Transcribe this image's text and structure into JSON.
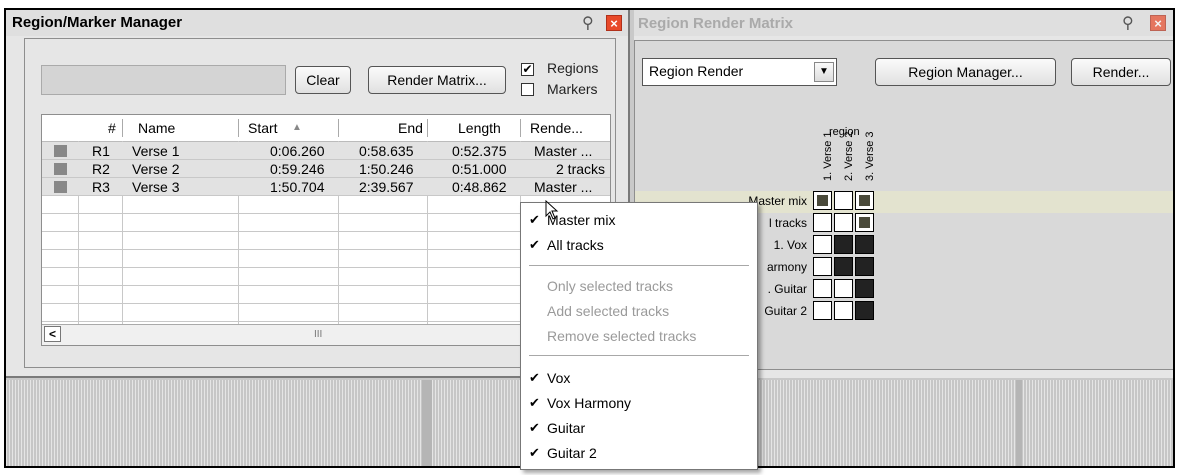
{
  "manager": {
    "title": "Region/Marker Manager",
    "clear_label": "Clear",
    "render_matrix_label": "Render Matrix...",
    "regions_label": "Regions",
    "markers_label": "Markers",
    "regions_checked": true,
    "markers_checked": false,
    "columns": [
      "#",
      "Name",
      "Start",
      "End",
      "Length",
      "Rende..."
    ],
    "sort_indicator": "▲",
    "rows": [
      {
        "num": "R1",
        "name": "Verse 1",
        "start": "0:06.260",
        "end": "0:58.635",
        "length": "0:52.375",
        "render": "Master ..."
      },
      {
        "num": "R2",
        "name": "Verse 2",
        "start": "0:59.246",
        "end": "1:50.246",
        "length": "0:51.000",
        "render": "2 tracks"
      },
      {
        "num": "R3",
        "name": "Verse 3",
        "start": "1:50.704",
        "end": "2:39.567",
        "length": "0:48.862",
        "render": "Master ..."
      }
    ],
    "scroll_grip": "III"
  },
  "matrix": {
    "title": "Region Render Matrix",
    "select_value": "Region Render",
    "region_manager_label": "Region Manager...",
    "render_label": "Render...",
    "region_header": "region",
    "columns": [
      "1. Verse 1",
      "2. Verse 2",
      "3. Verse 3"
    ],
    "rows": [
      {
        "label": "Master mix",
        "cells": [
          "partial",
          "off",
          "partial"
        ]
      },
      {
        "label": "l tracks",
        "cells": [
          "off",
          "off",
          "on"
        ]
      },
      {
        "label": "1. Vox",
        "cells": [
          "off",
          "on",
          "on"
        ]
      },
      {
        "label": "armony",
        "cells": [
          "off",
          "on",
          "on"
        ]
      },
      {
        "label": ". Guitar",
        "cells": [
          "off",
          "off",
          "on"
        ]
      },
      {
        "label": "Guitar 2",
        "cells": [
          "off",
          "off",
          "on"
        ]
      }
    ]
  },
  "menu": {
    "items": [
      {
        "label": "Master mix",
        "checked": true,
        "disabled": false
      },
      {
        "label": "All tracks",
        "checked": true,
        "disabled": false
      },
      {
        "label": "Only selected tracks",
        "checked": false,
        "disabled": true
      },
      {
        "label": "Add selected tracks",
        "checked": false,
        "disabled": true
      },
      {
        "label": "Remove selected tracks",
        "checked": false,
        "disabled": true
      },
      {
        "label": "Vox",
        "checked": true,
        "disabled": false
      },
      {
        "label": "Vox Harmony",
        "checked": true,
        "disabled": false
      },
      {
        "label": "Guitar",
        "checked": true,
        "disabled": false
      },
      {
        "label": "Guitar 2",
        "checked": true,
        "disabled": false
      }
    ]
  },
  "icons": {
    "pin": "pin-icon",
    "close": "close-icon",
    "check": "checkmark-icon",
    "dropdown": "chevron-down-icon",
    "scroll_left": "arrow-left-icon"
  },
  "colors": {
    "close_button": "#e84a2a",
    "row_highlight": "#e3e3cf"
  }
}
